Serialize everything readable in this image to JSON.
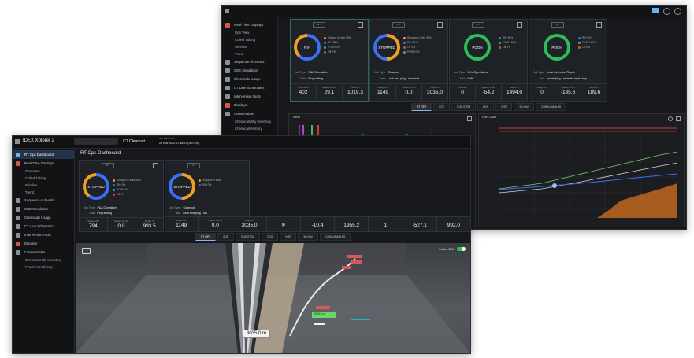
{
  "back": {
    "sidebar": {
      "items": [
        {
          "label": "Real-Time Displays"
        },
        {
          "label": "Ops View"
        },
        {
          "label": "Coiled Tubing"
        },
        {
          "label": "Wireline"
        },
        {
          "label": "Trend"
        },
        {
          "label": "Sequence of Events"
        },
        {
          "label": "SOE Simulation"
        },
        {
          "label": "Chemicals Usage"
        },
        {
          "label": "CT Line Schematics"
        },
        {
          "label": "Intervention Tools"
        },
        {
          "label": "Displays"
        },
        {
          "label": "Consumables"
        },
        {
          "label": "Chemicals Bly Inventory"
        },
        {
          "label": "Chemicals History"
        }
      ]
    },
    "cards": [
      {
        "tag": "RT",
        "status": "RIH",
        "legend": [
          "Tripped in Hole 38%",
          "RIH 38%",
          "POOH 0%",
          "Off 0%"
        ],
        "job_type": "P&A Operations",
        "task": "Plug setting",
        "metrics": [
          {
            "label": "Tension lbf",
            "value": "402"
          },
          {
            "label": "Speed m/min",
            "value": "29.1"
          },
          {
            "label": "Depth m",
            "value": "1019.3"
          }
        ]
      },
      {
        "tag": "CT",
        "status": "STOPPED",
        "legend": [
          "Stopped in Well 30%",
          "RIH 38%",
          "Off 0%",
          "POOH 0%"
        ],
        "job_type": "Cleanout",
        "task": "Leak test plug - standard",
        "metrics": [
          {
            "label": "Weight lbf",
            "value": "1149"
          },
          {
            "label": "Speed m/min",
            "value": "0.0"
          },
          {
            "label": "Depth m",
            "value": "3035.0"
          }
        ]
      },
      {
        "tag": "RT",
        "status": "POOH",
        "legend": [
          "RIH 50%",
          "POOH 50%",
          "Off 0%"
        ],
        "job_type": "GLV Operations",
        "task": "Drift",
        "metrics": [
          {
            "label": "Tension",
            "value": "0"
          },
          {
            "label": "Speed m/min",
            "value": "-54.2"
          },
          {
            "label": "Depth m",
            "value": "1494.0"
          }
        ]
      },
      {
        "tag": "CT",
        "status": "POOH",
        "legend": [
          "RIH 50%",
          "POOH 50%",
          "Off 0%"
        ],
        "job_type": "Leak Detection/Repair",
        "task": "Install plug - replicate lead chop",
        "metrics": [
          {
            "label": "Weight lbf",
            "value": "0"
          },
          {
            "label": "Speed m/min",
            "value": "-185.6"
          },
          {
            "label": "Depth m",
            "value": "189.6"
          }
        ]
      }
    ],
    "tabs": [
      "RT OPS",
      "SOE",
      "SOE STEM",
      "DOS",
      "KGE",
      "3D NAV",
      "CONSUMABLES"
    ],
    "trend_title": "Trend",
    "chart2_title": "Plan Chart"
  },
  "front": {
    "app_title": "IDEX Xplorer 2",
    "job_label": "CT Cleanout",
    "date_label": "Job Start Time",
    "date": "29 Nov 2022 17:38:57 (UTC+0)",
    "page_title": "RT Ops Dashboard",
    "sidebar": {
      "items": [
        {
          "label": "RT Ops Dashboard"
        },
        {
          "label": "Real-Time Displays"
        },
        {
          "label": "Ops View"
        },
        {
          "label": "Coiled Tubing"
        },
        {
          "label": "Wireline"
        },
        {
          "label": "Trend"
        },
        {
          "label": "Sequence of Events"
        },
        {
          "label": "SOE Simulation"
        },
        {
          "label": "Chemicals Usage"
        },
        {
          "label": "CT Line Schematics"
        },
        {
          "label": "Intervention Tools"
        },
        {
          "label": "Displays"
        },
        {
          "label": "Consumables"
        },
        {
          "label": "Chemicals Bly Inventory"
        },
        {
          "label": "Chemicals History"
        }
      ]
    },
    "cards": [
      {
        "tag": "RT",
        "status": "STOPPED",
        "legend": [
          "Stopped in Well 30%",
          "RIH 0%",
          "POOH 0%",
          "Off 0%"
        ],
        "job_type": "P&A Operations",
        "task": "Plug setting",
        "metrics": [
          {
            "label": "Tension lbf",
            "value": "794"
          },
          {
            "label": "Speed m/min",
            "value": "0.0"
          },
          {
            "label": "Depth m",
            "value": "993.5"
          }
        ]
      },
      {
        "tag": "CT",
        "status": "STOPPED",
        "legend": [
          "Stopped in Well",
          "RIH 0%"
        ],
        "job_type": "Cleanout",
        "task": "Leak test plug - sta",
        "metrics": [
          {
            "label": "Weight lbf",
            "value": "1149"
          },
          {
            "label": "Speed m/min",
            "value": "0.0"
          },
          {
            "label": "Depth m",
            "value": "3035.0"
          }
        ]
      }
    ],
    "extra_metrics": [
      "-10.4",
      "1955.2",
      "1",
      "-527.1",
      "992.0"
    ],
    "tabs": [
      "RT OPS",
      "SOE",
      "SOE STEM",
      "DOS",
      "KGE",
      "3D NAV",
      "CONSUMABLES"
    ],
    "follow_drill_label": "Follow Drill",
    "depth_label": "3035.0 m",
    "tool_label": "3035.0 m"
  }
}
